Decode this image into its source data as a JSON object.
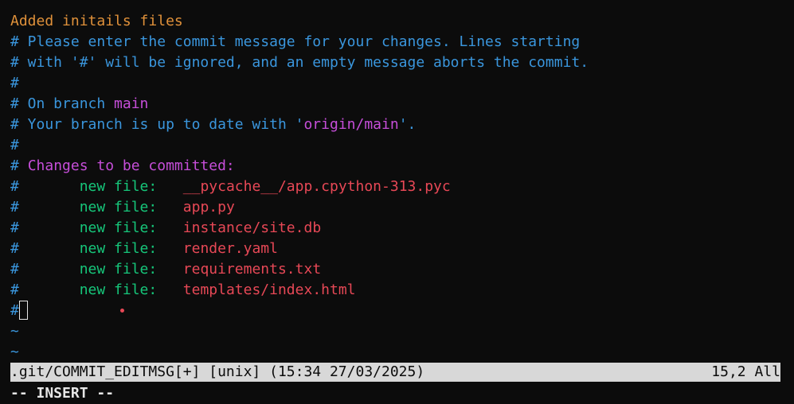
{
  "editor": {
    "commit_message": "Added initails files",
    "comment_line1": "# Please enter the commit message for your changes. Lines starting",
    "comment_line2": "# with '#' will be ignored, and an empty message aborts the commit.",
    "hash": "#",
    "branch_prefix": "# On branch ",
    "branch_name": "main",
    "uptodate_prefix": "# Your branch is up to date with ",
    "uptodate_quote_open": "'",
    "remote_branch": "origin/main",
    "uptodate_suffix": "'.",
    "changes_header": "Changes to be committed:",
    "new_file_label": "new file:",
    "files": [
      "__pycache__/app.cpython-313.pyc",
      "app.py",
      "instance/site.db",
      "render.yaml",
      "requirements.txt",
      "templates/index.html"
    ],
    "tilde": "~"
  },
  "status": {
    "file_info": ".git/COMMIT_EDITMSG[+] [unix] (15:34 27/03/2025)",
    "position": "15,2 All"
  },
  "mode": "-- INSERT --",
  "colors": {
    "commit_message": "#e0913a",
    "comment": "#3a96dd",
    "highlight": "#c64ed9",
    "new_file": "#16c67a",
    "filename": "#e74856",
    "background": "#0c0c0c",
    "statusline_bg": "#d8d8d8"
  }
}
